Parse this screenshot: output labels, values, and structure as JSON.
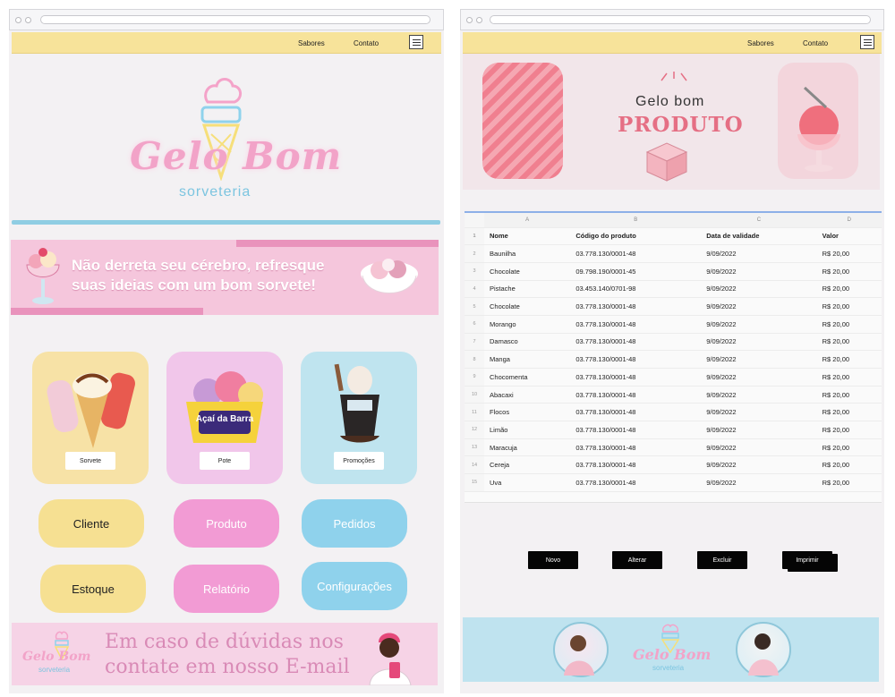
{
  "left": {
    "nav": {
      "links": [
        "Sabores",
        "Contato"
      ]
    },
    "logo": {
      "title": "Gelo Bom",
      "subtitle": "sorveteria"
    },
    "banner": {
      "text": "Não derreta seu cérebro, refresque suas ideias com um bom sorvete!"
    },
    "cards": [
      {
        "label": "Sorvete",
        "color": "#f7e2a6"
      },
      {
        "label": "Pote",
        "color": "#f1c6ea"
      },
      {
        "label": "Promoções",
        "color": "#bfe4ef"
      }
    ],
    "card_texts": {
      "brand": "Açaí da Barra"
    },
    "buttons": [
      {
        "label": "Cliente",
        "color": "#f6e092"
      },
      {
        "label": "Produto",
        "color": "#f29bd4"
      },
      {
        "label": "Pedidos",
        "color": "#8fd2ec"
      },
      {
        "label": "Estoque",
        "color": "#f6e092"
      },
      {
        "label": "Relatório",
        "color": "#f29bd4"
      },
      {
        "label": "Configurações",
        "color": "#8fd2ec"
      }
    ],
    "footer": {
      "text": "Em caso de dúvidas nos contate em nosso E-mail",
      "logo_title": "Gelo Bom",
      "logo_subtitle": "sorveteria"
    }
  },
  "right": {
    "nav": {
      "links": [
        "Sabores",
        "Contato"
      ]
    },
    "hero": {
      "small": "Gelo bom",
      "big": "PRODUTO"
    },
    "sheet": {
      "columns": [
        "A",
        "B",
        "C",
        "D"
      ],
      "headers": [
        "Nome",
        "Código do produto",
        "Data de validade",
        "Valor"
      ],
      "rows": [
        [
          "2",
          "Baunilha",
          "03.778.130/0001-48",
          "9/09/2022",
          "R$ 20,00"
        ],
        [
          "3",
          "Chocolate",
          "09.798.190/0001-45",
          "9/09/2022",
          "R$ 20,00"
        ],
        [
          "4",
          "Pistache",
          "03.453.140/0701-98",
          "9/09/2022",
          "R$ 20,00"
        ],
        [
          "5",
          "Chocolate",
          "03.778.130/0001-48",
          "9/09/2022",
          "R$ 20,00"
        ],
        [
          "6",
          "Morango",
          "03.778.130/0001-48",
          "9/09/2022",
          "R$ 20,00"
        ],
        [
          "7",
          "Damasco",
          "03.778.130/0001-48",
          "9/09/2022",
          "R$ 20,00"
        ],
        [
          "8",
          "Manga",
          "03.778.130/0001-48",
          "9/09/2022",
          "R$ 20,00"
        ],
        [
          "9",
          "Chocomenta",
          "03.778.130/0001-48",
          "9/09/2022",
          "R$ 20,00"
        ],
        [
          "10",
          "Abacaxi",
          "03.778.130/0001-48",
          "9/09/2022",
          "R$ 20,00"
        ],
        [
          "11",
          "Flocos",
          "03.778.130/0001-48",
          "9/09/2022",
          "R$ 20,00"
        ],
        [
          "12",
          "Limão",
          "03.778.130/0001-48",
          "9/09/2022",
          "R$ 20,00"
        ],
        [
          "13",
          "Maracuja",
          "03.778.130/0001-48",
          "9/09/2022",
          "R$ 20,00"
        ],
        [
          "14",
          "Cereja",
          "03.778.130/0001-48",
          "9/09/2022",
          "R$ 20,00"
        ],
        [
          "15",
          "Uva",
          "03.778.130/0001-48",
          "9/09/2022",
          "R$ 20,00"
        ]
      ]
    },
    "actions": [
      "Novo",
      "Alterar",
      "Excluir",
      "Imprimir"
    ],
    "footer": {
      "logo_title": "Gelo Bom",
      "logo_subtitle": "sorveteria"
    }
  }
}
